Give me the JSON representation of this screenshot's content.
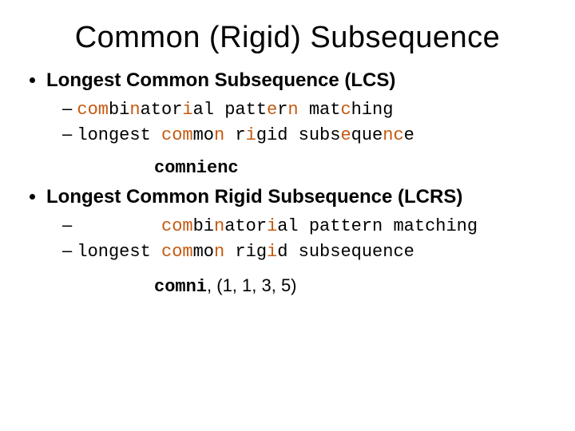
{
  "title": "Common (Rigid) Subsequence",
  "sections": [
    {
      "heading": "Longest Common Subsequence (LCS)",
      "lines": [
        {
          "dash": "– ",
          "indent": "",
          "chars": [
            {
              "t": "c",
              "hl": true
            },
            {
              "t": "o",
              "hl": true
            },
            {
              "t": "m",
              "hl": true
            },
            {
              "t": "b",
              "hl": false
            },
            {
              "t": "i",
              "hl": false
            },
            {
              "t": "n",
              "hl": true
            },
            {
              "t": "a",
              "hl": false
            },
            {
              "t": "t",
              "hl": false
            },
            {
              "t": "o",
              "hl": false
            },
            {
              "t": "r",
              "hl": false
            },
            {
              "t": "i",
              "hl": true
            },
            {
              "t": "a",
              "hl": false
            },
            {
              "t": "l",
              "hl": false
            },
            {
              "t": " ",
              "hl": false
            },
            {
              "t": "p",
              "hl": false
            },
            {
              "t": "a",
              "hl": false
            },
            {
              "t": "t",
              "hl": false
            },
            {
              "t": "t",
              "hl": false
            },
            {
              "t": "e",
              "hl": true
            },
            {
              "t": "r",
              "hl": false
            },
            {
              "t": "n",
              "hl": true
            },
            {
              "t": " ",
              "hl": false
            },
            {
              "t": "m",
              "hl": false
            },
            {
              "t": "a",
              "hl": false
            },
            {
              "t": "t",
              "hl": false
            },
            {
              "t": "c",
              "hl": true
            },
            {
              "t": "h",
              "hl": false
            },
            {
              "t": "i",
              "hl": false
            },
            {
              "t": "n",
              "hl": false
            },
            {
              "t": "g",
              "hl": false
            }
          ]
        },
        {
          "dash": "– ",
          "indent": "",
          "chars": [
            {
              "t": "l",
              "hl": false
            },
            {
              "t": "o",
              "hl": false
            },
            {
              "t": "n",
              "hl": false
            },
            {
              "t": "g",
              "hl": false
            },
            {
              "t": "e",
              "hl": false
            },
            {
              "t": "s",
              "hl": false
            },
            {
              "t": "t",
              "hl": false
            },
            {
              "t": " ",
              "hl": false
            },
            {
              "t": "c",
              "hl": true
            },
            {
              "t": "o",
              "hl": true
            },
            {
              "t": "m",
              "hl": true
            },
            {
              "t": "m",
              "hl": false
            },
            {
              "t": "o",
              "hl": false
            },
            {
              "t": "n",
              "hl": true
            },
            {
              "t": " ",
              "hl": false
            },
            {
              "t": "r",
              "hl": false
            },
            {
              "t": "i",
              "hl": true
            },
            {
              "t": "g",
              "hl": false
            },
            {
              "t": "i",
              "hl": false
            },
            {
              "t": "d",
              "hl": false
            },
            {
              "t": " ",
              "hl": false
            },
            {
              "t": "s",
              "hl": false
            },
            {
              "t": "u",
              "hl": false
            },
            {
              "t": "b",
              "hl": false
            },
            {
              "t": "s",
              "hl": false
            },
            {
              "t": "e",
              "hl": true
            },
            {
              "t": "q",
              "hl": false
            },
            {
              "t": "u",
              "hl": false
            },
            {
              "t": "e",
              "hl": false
            },
            {
              "t": "n",
              "hl": true
            },
            {
              "t": "c",
              "hl": true
            },
            {
              "t": "e",
              "hl": false
            }
          ]
        }
      ],
      "result": "comnienc",
      "tuple": ""
    },
    {
      "heading": "Longest Common Rigid Subsequence (LCRS)",
      "lines": [
        {
          "dash": "– ",
          "indent": "        ",
          "chars": [
            {
              "t": "c",
              "hl": true
            },
            {
              "t": "o",
              "hl": true
            },
            {
              "t": "m",
              "hl": true
            },
            {
              "t": "b",
              "hl": false
            },
            {
              "t": "i",
              "hl": false
            },
            {
              "t": "n",
              "hl": true
            },
            {
              "t": "a",
              "hl": false
            },
            {
              "t": "t",
              "hl": false
            },
            {
              "t": "o",
              "hl": false
            },
            {
              "t": "r",
              "hl": false
            },
            {
              "t": "i",
              "hl": true
            },
            {
              "t": "a",
              "hl": false
            },
            {
              "t": "l",
              "hl": false
            },
            {
              "t": " ",
              "hl": false
            },
            {
              "t": "p",
              "hl": false
            },
            {
              "t": "a",
              "hl": false
            },
            {
              "t": "t",
              "hl": false
            },
            {
              "t": "t",
              "hl": false
            },
            {
              "t": "e",
              "hl": false
            },
            {
              "t": "r",
              "hl": false
            },
            {
              "t": "n",
              "hl": false
            },
            {
              "t": " ",
              "hl": false
            },
            {
              "t": "m",
              "hl": false
            },
            {
              "t": "a",
              "hl": false
            },
            {
              "t": "t",
              "hl": false
            },
            {
              "t": "c",
              "hl": false
            },
            {
              "t": "h",
              "hl": false
            },
            {
              "t": "i",
              "hl": false
            },
            {
              "t": "n",
              "hl": false
            },
            {
              "t": "g",
              "hl": false
            }
          ]
        },
        {
          "dash": "– ",
          "indent": "",
          "chars": [
            {
              "t": "l",
              "hl": false
            },
            {
              "t": "o",
              "hl": false
            },
            {
              "t": "n",
              "hl": false
            },
            {
              "t": "g",
              "hl": false
            },
            {
              "t": "e",
              "hl": false
            },
            {
              "t": "s",
              "hl": false
            },
            {
              "t": "t",
              "hl": false
            },
            {
              "t": " ",
              "hl": false
            },
            {
              "t": "c",
              "hl": true
            },
            {
              "t": "o",
              "hl": true
            },
            {
              "t": "m",
              "hl": true
            },
            {
              "t": "m",
              "hl": false
            },
            {
              "t": "o",
              "hl": false
            },
            {
              "t": "n",
              "hl": true
            },
            {
              "t": " ",
              "hl": false
            },
            {
              "t": "r",
              "hl": false
            },
            {
              "t": "i",
              "hl": false
            },
            {
              "t": "g",
              "hl": false
            },
            {
              "t": "i",
              "hl": true
            },
            {
              "t": "d",
              "hl": false
            },
            {
              "t": " ",
              "hl": false
            },
            {
              "t": "s",
              "hl": false
            },
            {
              "t": "u",
              "hl": false
            },
            {
              "t": "b",
              "hl": false
            },
            {
              "t": "s",
              "hl": false
            },
            {
              "t": "e",
              "hl": false
            },
            {
              "t": "q",
              "hl": false
            },
            {
              "t": "u",
              "hl": false
            },
            {
              "t": "e",
              "hl": false
            },
            {
              "t": "n",
              "hl": false
            },
            {
              "t": "c",
              "hl": false
            },
            {
              "t": "e",
              "hl": false
            }
          ]
        }
      ],
      "result": "comni",
      "tuple": ", (1, 1, 3, 5)"
    }
  ]
}
